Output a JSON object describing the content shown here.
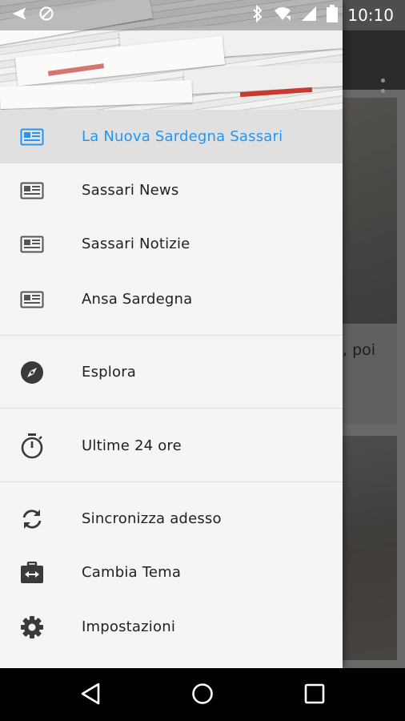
{
  "status_bar": {
    "time": "10:10"
  },
  "background": {
    "snippet": ", poi"
  },
  "drawer": {
    "items": [
      {
        "label": "La Nuova Sardegna Sassari",
        "icon": "newspaper-icon",
        "selected": true
      },
      {
        "label": "Sassari News",
        "icon": "newspaper-icon"
      },
      {
        "label": "Sassari Notizie",
        "icon": "newspaper-icon"
      },
      {
        "label": "Ansa Sardegna",
        "icon": "newspaper-icon"
      },
      {
        "label": "Esplora",
        "icon": "compass-icon"
      },
      {
        "label": "Ultime 24 ore",
        "icon": "timer-icon"
      },
      {
        "label": "Sincronizza adesso",
        "icon": "sync-icon"
      },
      {
        "label": "Cambia Tema",
        "icon": "switch-theme-icon"
      },
      {
        "label": "Impostazioni",
        "icon": "gear-icon"
      }
    ]
  },
  "colors": {
    "accent": "#2196f3",
    "drawer_bg": "#f5f5f5",
    "selected_bg": "#e0e0e0"
  }
}
